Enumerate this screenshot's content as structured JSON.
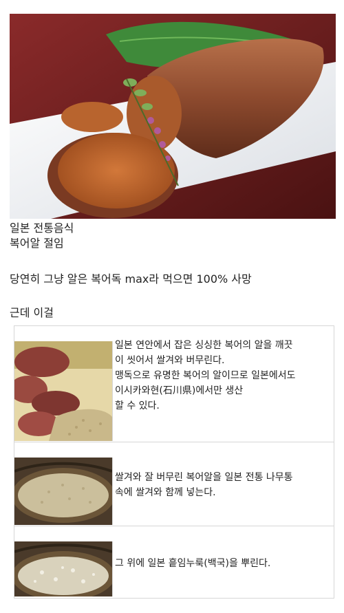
{
  "hero": {
    "image": "salted-pufferfish-roe-on-plate"
  },
  "intro": {
    "line1": "일본 전통음식",
    "line2": "복어알 절임",
    "line3": "당연히 그냥 알은 복어독 max라 먹으면 100% 사망",
    "line4": "근데 이걸"
  },
  "steps": [
    {
      "image": "pufferfish-roe-with-rice-bran",
      "lines": [
        "일본 연안에서 잡은 싱싱한 복어의 알을 깨끗",
        "이 씻어서 쌀겨와 버무린다.",
        " 맹독으로 유명한 복어의 알이므로 일본에서도",
        "이시카와현(石川県)에서만 생산",
        " 할 수 있다."
      ]
    },
    {
      "image": "wooden-barrel-with-rice-bran",
      "lines": [
        "쌀겨와 잘 버무린 복어알을 일본 전통 나무통",
        "속에 쌀겨와 함께 넣는다."
      ]
    },
    {
      "image": "wooden-barrel-with-koji",
      "lines": [
        "그 위에 일본 흩임누룩(백국)을 뿌린다."
      ]
    }
  ]
}
